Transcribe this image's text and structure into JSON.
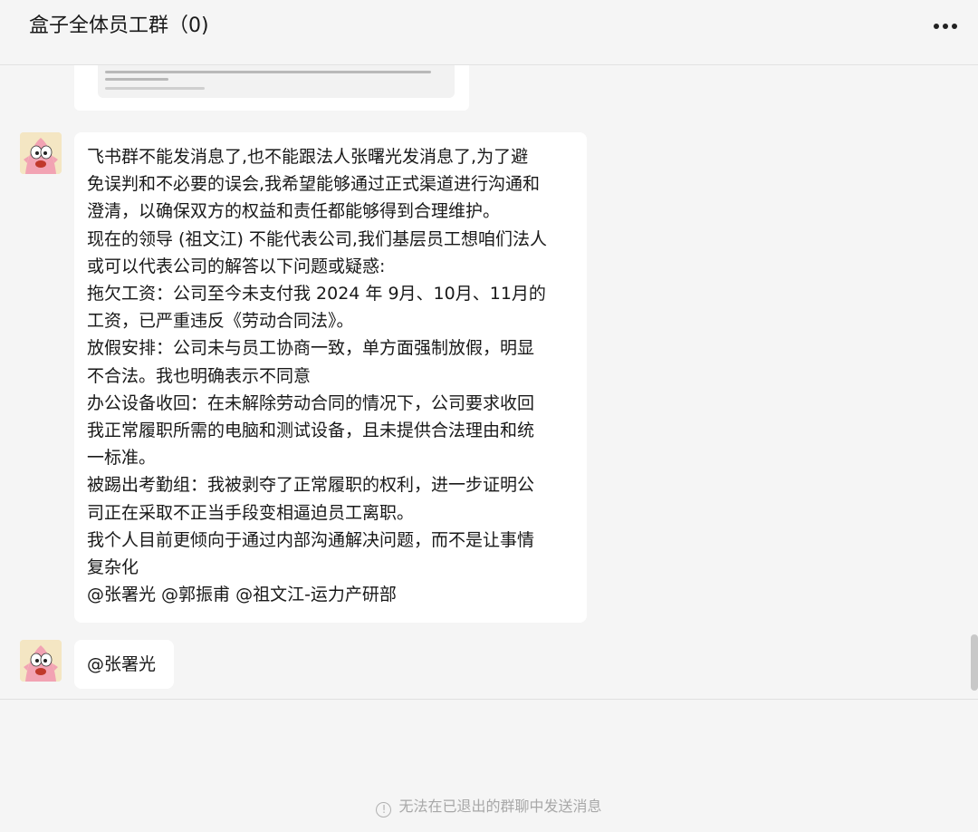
{
  "header": {
    "title": "盒子全体员工群（0)",
    "more_icon": "more-horizontal-icon"
  },
  "messages": [
    {
      "type": "image",
      "content": "screenshot-preview"
    },
    {
      "type": "text",
      "avatar_icon": "patrick-star-avatar",
      "lines": [
        "飞书群不能发消息了,也不能跟法人张曙光发消息了,为了避",
        "免误判和不必要的误会,我希望能够通过正式渠道进行沟通和",
        "澄清，以确保双方的权益和责任都能够得到合理维护。",
        "现在的领导 (祖文江) 不能代表公司,我们基层员工想咱们法人",
        "或可以代表公司的解答以下问题或疑惑:",
        "拖欠工资：公司至今未支付我 2024 年 9月、10月、11月的",
        "工资，已严重违反《劳动合同法》。",
        "放假安排：公司未与员工协商一致，单方面强制放假，明显",
        "不合法。我也明确表示不同意",
        "办公设备收回：在未解除劳动合同的情况下，公司要求收回",
        "我正常履职所需的电脑和测试设备，且未提供合法理由和统",
        "一标准。",
        "被踢出考勤组：我被剥夺了正常履职的权利，进一步证明公",
        "司正在采取不正当手段变相逼迫员工离职。",
        "我个人目前更倾向于通过内部沟通解决问题，而不是让事情",
        "复杂化",
        "@张署光 @郭振甫 @祖文江-运力产研部"
      ]
    },
    {
      "type": "text",
      "avatar_icon": "patrick-star-avatar",
      "lines": [
        "@张署光"
      ]
    }
  ],
  "footer": {
    "notice": "无法在已退出的群聊中发送消息",
    "notice_icon": "info-circle-icon"
  }
}
